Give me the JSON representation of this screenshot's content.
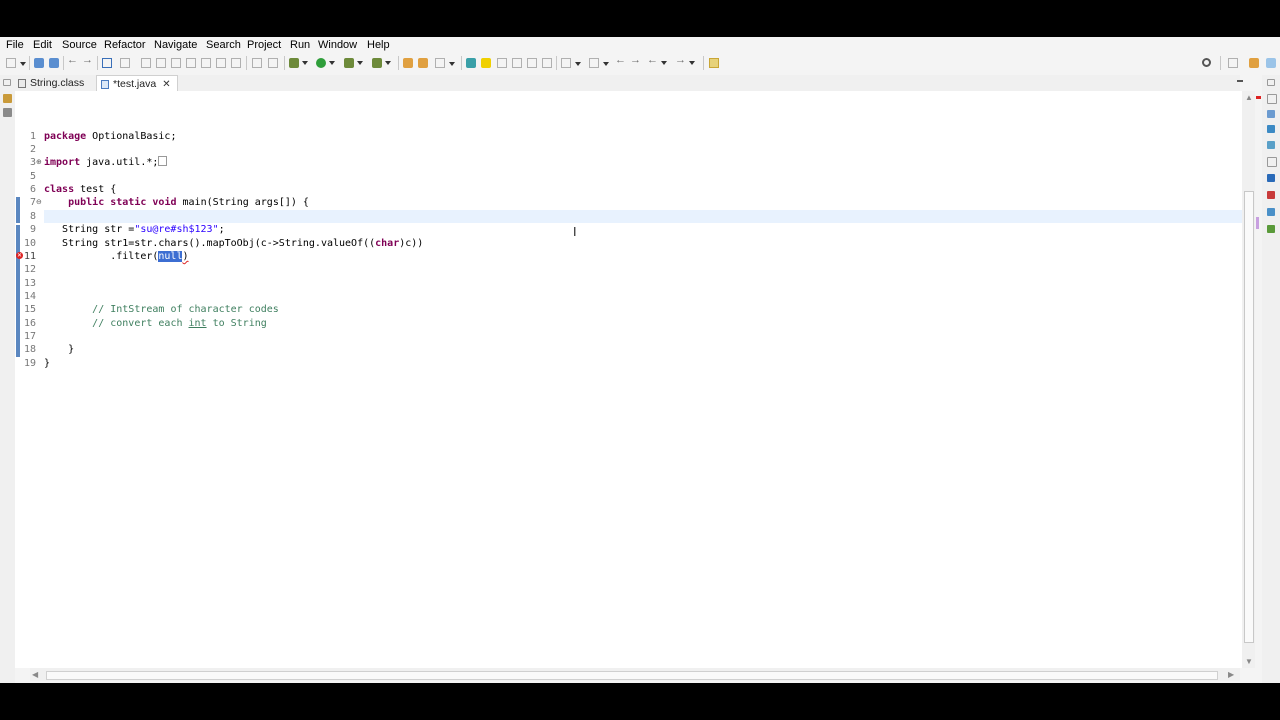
{
  "menu": [
    "File",
    "Edit",
    "Source",
    "Refactor",
    "Navigate",
    "Search",
    "Project",
    "Run",
    "Window",
    "Help"
  ],
  "tabs": {
    "inactive_label": "String.class",
    "active_label": "*test.java",
    "close_glyph": "✕"
  },
  "editor": {
    "line_numbers": [
      "1",
      "2",
      "3",
      "5",
      "6",
      "7",
      "8",
      "9",
      "10",
      "11",
      "12",
      "13",
      "14",
      "15",
      "16",
      "17",
      "18",
      "19"
    ],
    "code": {
      "l1_kw": "package",
      "l1_rest": " OptionalBasic;",
      "l3_kw": "import",
      "l3_rest": " java.util.*;",
      "l6_kw": "class",
      "l6_rest": " test {",
      "l7_indent": "    ",
      "l7_kw1": "public",
      "l7_kw2": "static",
      "l7_kw3": "void",
      "l7_rest": " main(String args[]) {",
      "l9_pre": "   String str =",
      "l9_str": "\"su@re#sh$123\"",
      "l9_post": ";",
      "l10_pre": "   String str1=str.chars().mapToObj(c->String.valueOf((",
      "l10_kw": "char",
      "l10_post": ")c))",
      "l11_pre": "           .filter(",
      "l11_sel": "null",
      "l11_post": ")",
      "l15_indent": "        ",
      "l15_cmt": "// IntStream of character codes",
      "l16_indent": "        ",
      "l16_cmt_a": "// convert each ",
      "l16_cmt_int": "int",
      "l16_cmt_b": " to String",
      "l18": "    }",
      "l19": "}"
    }
  },
  "colors": {
    "keyword": "#7f0055",
    "string": "#2a00ff",
    "comment": "#3f7f5f",
    "current_line": "#e8f2fe",
    "selection": "#3c6ed2",
    "error": "#dd2222"
  },
  "icons": {
    "error_marker": "error-icon",
    "fold": "fold-icon",
    "text_cursor": "i-beam-cursor-icon"
  }
}
